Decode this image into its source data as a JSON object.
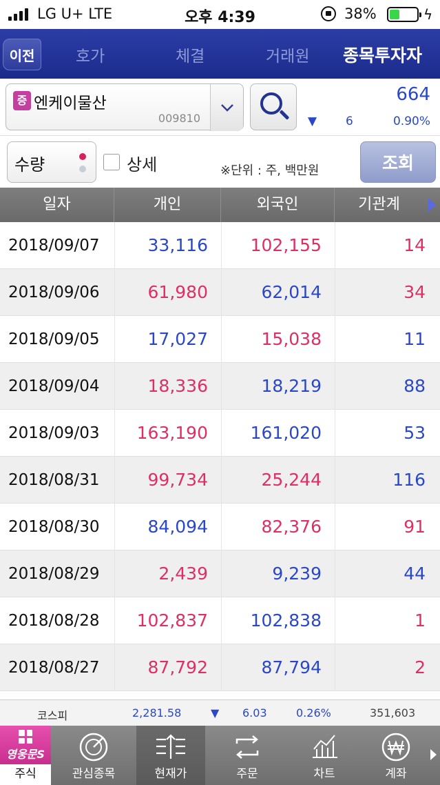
{
  "status": {
    "carrier": "LG U+  LTE",
    "time": "오후 4:39",
    "battery_pct": "38%",
    "battery_level": 0.38,
    "battery_color": "#39d64a"
  },
  "nav": {
    "back_label": "이전",
    "tabs": [
      {
        "label": "호가"
      },
      {
        "label": "체결"
      },
      {
        "label": "거래원"
      },
      {
        "label": "종목투자자"
      }
    ],
    "active_tab": "종목투자자",
    "bg_color": "#1b2b8c"
  },
  "stock": {
    "badge": "증",
    "name": "엔케이물산",
    "code": "009810",
    "price": "664",
    "change_arrow": "▼",
    "change": "6",
    "change_pct": "0.90%"
  },
  "options": {
    "qty_label": "수량",
    "detail_label": "상세",
    "unit_note": "※단위 : 주, 백만원",
    "query_label": "조회"
  },
  "table": {
    "headers": [
      "일자",
      "개인",
      "외국인",
      "기관계"
    ],
    "rows": [
      {
        "date": "2018/09/07",
        "individual": "33,116",
        "foreign": "102,155",
        "institution": "14"
      },
      {
        "date": "2018/09/06",
        "individual": "61,980",
        "foreign": "62,014",
        "institution": "34"
      },
      {
        "date": "2018/09/05",
        "individual": "17,027",
        "foreign": "15,038",
        "institution": "11"
      },
      {
        "date": "2018/09/04",
        "individual": "18,336",
        "foreign": "18,219",
        "institution": "88"
      },
      {
        "date": "2018/09/03",
        "individual": "163,190",
        "foreign": "161,020",
        "institution": "53"
      },
      {
        "date": "2018/08/31",
        "individual": "99,734",
        "foreign": "25,244",
        "institution": "116"
      },
      {
        "date": "2018/08/30",
        "individual": "84,094",
        "foreign": "82,376",
        "institution": "91"
      },
      {
        "date": "2018/08/29",
        "individual": "2,439",
        "foreign": "9,239",
        "institution": "44"
      },
      {
        "date": "2018/08/28",
        "individual": "102,837",
        "foreign": "102,838",
        "institution": "1"
      },
      {
        "date": "2018/08/27",
        "individual": "87,792",
        "foreign": "87,794",
        "institution": "2"
      }
    ],
    "buy_color": "#de2f65",
    "sell_color": "#2a47c9"
  },
  "index_bar": {
    "name": "코스피",
    "value": "2,281.58",
    "arrow": "▼",
    "change": "6.03",
    "change_pct": "0.26%",
    "volume": "351,603"
  },
  "bottom_nav": {
    "home_brand": "영웅문S",
    "home_label": "주식",
    "items": [
      {
        "label": "관심종목",
        "icon": "target-icon"
      },
      {
        "label": "현재가",
        "icon": "current-price-icon"
      },
      {
        "label": "주문",
        "icon": "order-icon"
      },
      {
        "label": "차트",
        "icon": "chart-icon"
      },
      {
        "label": "계좌",
        "icon": "won-icon"
      }
    ],
    "current": "현재가"
  }
}
